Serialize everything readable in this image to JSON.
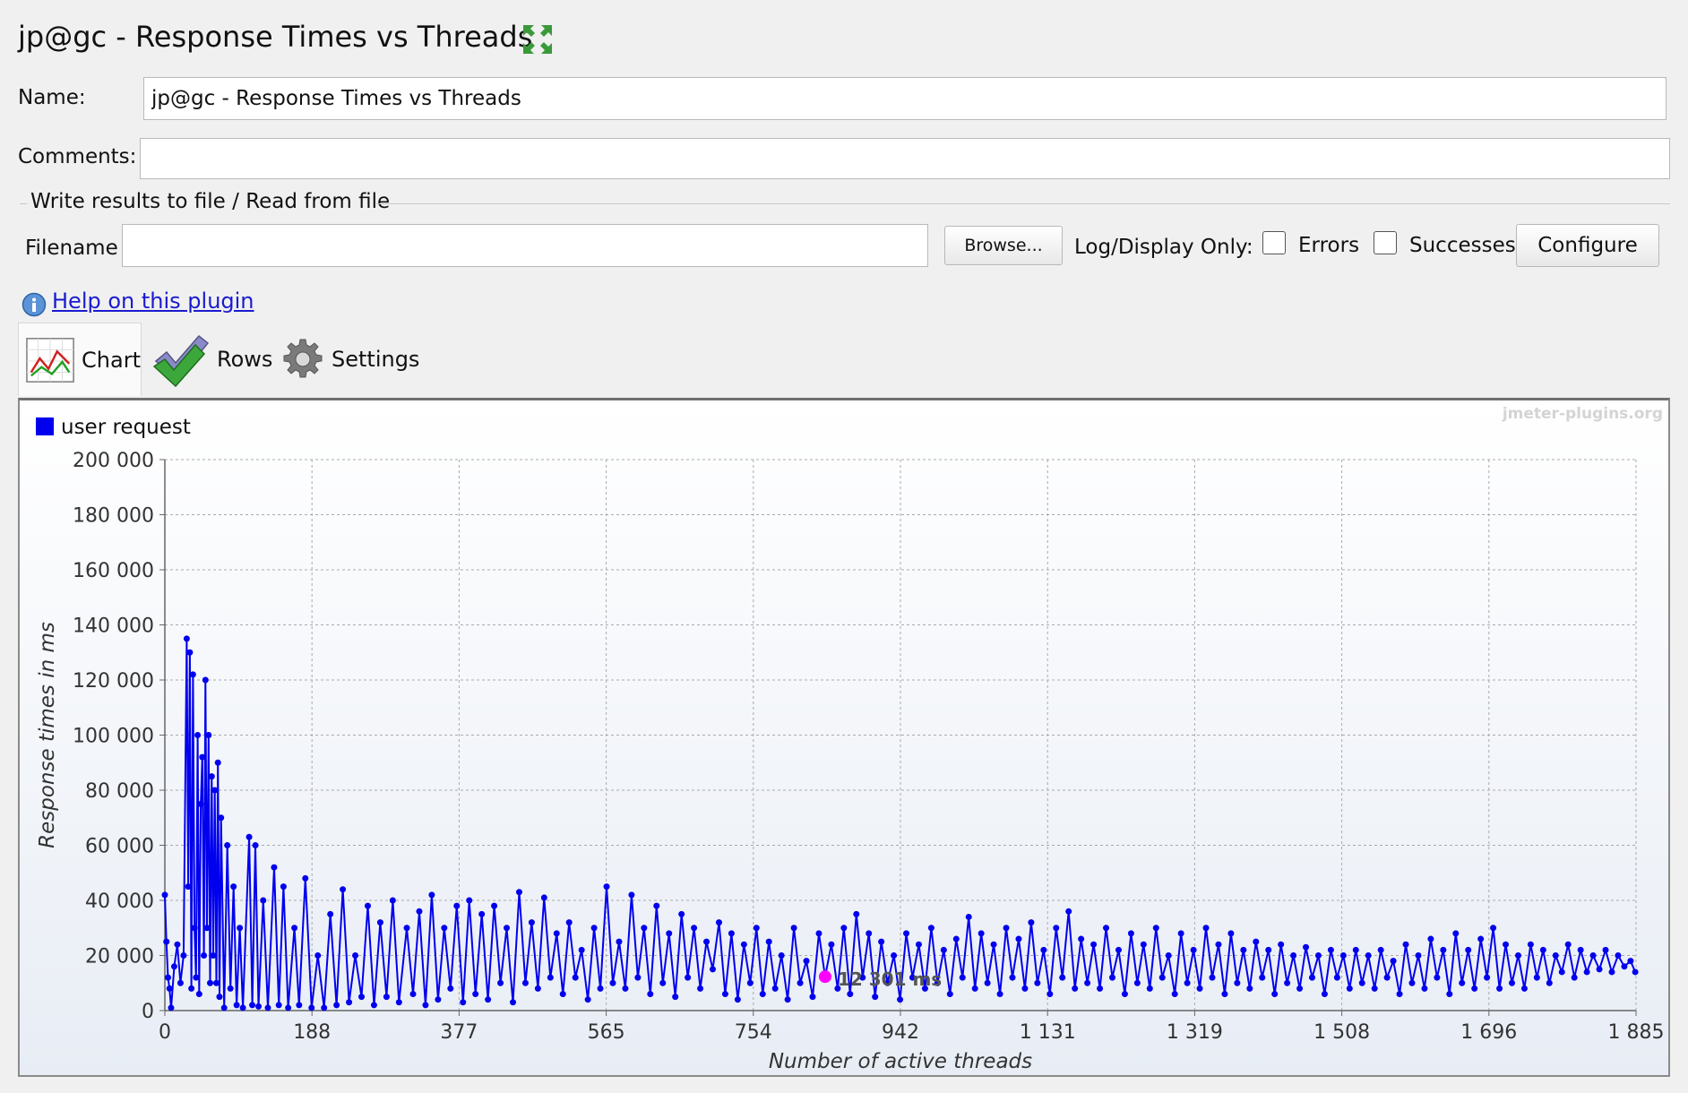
{
  "window": {
    "title": "jp@gc - Response Times vs Threads"
  },
  "form": {
    "name_label": "Name:",
    "name_value": "jp@gc - Response Times vs Threads",
    "comments_label": "Comments:",
    "comments_value": "",
    "file_group_label": "Write results to file / Read from file",
    "filename_label": "Filename",
    "filename_value": "",
    "browse_label": "Browse...",
    "log_display_label": "Log/Display Only:",
    "errors_label": "Errors",
    "errors_checked": false,
    "successes_label": "Successes",
    "successes_checked": false,
    "configure_label": "Configure"
  },
  "help": {
    "link_label": "Help on this plugin",
    "icon": "info-icon"
  },
  "tabs": [
    {
      "label": "Chart",
      "icon": "chart-icon",
      "selected": true
    },
    {
      "label": "Rows",
      "icon": "checkmark-icon",
      "selected": false
    },
    {
      "label": "Settings",
      "icon": "gear-icon",
      "selected": false
    }
  ],
  "chart_data": {
    "type": "line",
    "watermark": "jmeter-plugins.org",
    "xlabel": "Number of active threads",
    "ylabel": "Response times in ms",
    "xlim": [
      0,
      1885
    ],
    "ylim": [
      0,
      200000
    ],
    "x_ticks": [
      "0",
      "188",
      "377",
      "565",
      "754",
      "942",
      "1 131",
      "1 319",
      "1 508",
      "1 696",
      "1 885"
    ],
    "y_ticks": [
      "0",
      "20 000",
      "40 000",
      "60 000",
      "80 000",
      "100 000",
      "120 000",
      "140 000",
      "160 000",
      "180 000",
      "200 000"
    ],
    "grid": true,
    "legend_position": "top-left",
    "series": [
      {
        "name": "user request",
        "color": "#0000ee",
        "points": [
          [
            0,
            42000
          ],
          [
            2,
            25000
          ],
          [
            4,
            12000
          ],
          [
            6,
            8000
          ],
          [
            8,
            1000
          ],
          [
            12,
            16000
          ],
          [
            16,
            24000
          ],
          [
            20,
            10000
          ],
          [
            24,
            20000
          ],
          [
            28,
            135000
          ],
          [
            30,
            45000
          ],
          [
            32,
            130000
          ],
          [
            34,
            8000
          ],
          [
            36,
            122000
          ],
          [
            38,
            30000
          ],
          [
            40,
            12000
          ],
          [
            42,
            100000
          ],
          [
            44,
            6000
          ],
          [
            46,
            75000
          ],
          [
            48,
            92000
          ],
          [
            50,
            20000
          ],
          [
            52,
            120000
          ],
          [
            54,
            30000
          ],
          [
            56,
            100000
          ],
          [
            58,
            10000
          ],
          [
            60,
            85000
          ],
          [
            62,
            20000
          ],
          [
            64,
            80000
          ],
          [
            66,
            10000
          ],
          [
            68,
            90000
          ],
          [
            70,
            5000
          ],
          [
            72,
            70000
          ],
          [
            76,
            1000
          ],
          [
            80,
            60000
          ],
          [
            84,
            8000
          ],
          [
            88,
            45000
          ],
          [
            92,
            2000
          ],
          [
            96,
            30000
          ],
          [
            100,
            1000
          ],
          [
            108,
            63000
          ],
          [
            112,
            2000
          ],
          [
            116,
            60000
          ],
          [
            120,
            1500
          ],
          [
            126,
            40000
          ],
          [
            132,
            1000
          ],
          [
            140,
            52000
          ],
          [
            146,
            2000
          ],
          [
            152,
            45000
          ],
          [
            158,
            1000
          ],
          [
            166,
            30000
          ],
          [
            172,
            2000
          ],
          [
            180,
            48000
          ],
          [
            188,
            1000
          ],
          [
            196,
            20000
          ],
          [
            204,
            1000
          ],
          [
            212,
            35000
          ],
          [
            220,
            2000
          ],
          [
            228,
            44000
          ],
          [
            236,
            3000
          ],
          [
            244,
            20000
          ],
          [
            252,
            5000
          ],
          [
            260,
            38000
          ],
          [
            268,
            2000
          ],
          [
            276,
            32000
          ],
          [
            284,
            5000
          ],
          [
            292,
            40000
          ],
          [
            300,
            3000
          ],
          [
            310,
            30000
          ],
          [
            318,
            6000
          ],
          [
            326,
            36000
          ],
          [
            334,
            2000
          ],
          [
            342,
            42000
          ],
          [
            350,
            4000
          ],
          [
            358,
            30000
          ],
          [
            366,
            8000
          ],
          [
            374,
            38000
          ],
          [
            382,
            3000
          ],
          [
            390,
            40000
          ],
          [
            398,
            6000
          ],
          [
            406,
            35000
          ],
          [
            414,
            4000
          ],
          [
            422,
            38000
          ],
          [
            430,
            10000
          ],
          [
            438,
            30000
          ],
          [
            446,
            3000
          ],
          [
            454,
            43000
          ],
          [
            462,
            10000
          ],
          [
            470,
            32000
          ],
          [
            478,
            8000
          ],
          [
            486,
            41000
          ],
          [
            494,
            12000
          ],
          [
            502,
            28000
          ],
          [
            510,
            6000
          ],
          [
            518,
            32000
          ],
          [
            526,
            12000
          ],
          [
            534,
            22000
          ],
          [
            542,
            4000
          ],
          [
            550,
            30000
          ],
          [
            558,
            8000
          ],
          [
            566,
            45000
          ],
          [
            574,
            10000
          ],
          [
            582,
            25000
          ],
          [
            590,
            8000
          ],
          [
            598,
            42000
          ],
          [
            606,
            12000
          ],
          [
            614,
            30000
          ],
          [
            622,
            6000
          ],
          [
            630,
            38000
          ],
          [
            638,
            10000
          ],
          [
            646,
            28000
          ],
          [
            654,
            5000
          ],
          [
            662,
            35000
          ],
          [
            670,
            12000
          ],
          [
            678,
            30000
          ],
          [
            686,
            8000
          ],
          [
            694,
            25000
          ],
          [
            702,
            15000
          ],
          [
            710,
            32000
          ],
          [
            718,
            6000
          ],
          [
            726,
            28000
          ],
          [
            734,
            4000
          ],
          [
            742,
            24000
          ],
          [
            750,
            10000
          ],
          [
            758,
            30000
          ],
          [
            766,
            6000
          ],
          [
            774,
            25000
          ],
          [
            782,
            8000
          ],
          [
            790,
            20000
          ],
          [
            798,
            4000
          ],
          [
            806,
            30000
          ],
          [
            814,
            10000
          ],
          [
            822,
            18000
          ],
          [
            830,
            5000
          ],
          [
            838,
            28000
          ],
          [
            846,
            12300
          ],
          [
            854,
            24000
          ],
          [
            862,
            8000
          ],
          [
            870,
            30000
          ],
          [
            878,
            6000
          ],
          [
            886,
            35000
          ],
          [
            894,
            12000
          ],
          [
            902,
            28000
          ],
          [
            910,
            5000
          ],
          [
            918,
            25000
          ],
          [
            926,
            10000
          ],
          [
            934,
            20000
          ],
          [
            942,
            4000
          ],
          [
            950,
            28000
          ],
          [
            958,
            12000
          ],
          [
            966,
            24000
          ],
          [
            974,
            8000
          ],
          [
            982,
            30000
          ],
          [
            990,
            10000
          ],
          [
            998,
            22000
          ],
          [
            1006,
            6000
          ],
          [
            1014,
            26000
          ],
          [
            1022,
            12000
          ],
          [
            1030,
            34000
          ],
          [
            1038,
            8000
          ],
          [
            1046,
            28000
          ],
          [
            1054,
            10000
          ],
          [
            1062,
            24000
          ],
          [
            1070,
            6000
          ],
          [
            1078,
            30000
          ],
          [
            1086,
            12000
          ],
          [
            1094,
            26000
          ],
          [
            1102,
            8000
          ],
          [
            1110,
            32000
          ],
          [
            1118,
            10000
          ],
          [
            1126,
            22000
          ],
          [
            1134,
            6000
          ],
          [
            1142,
            30000
          ],
          [
            1150,
            12000
          ],
          [
            1158,
            36000
          ],
          [
            1166,
            8000
          ],
          [
            1174,
            26000
          ],
          [
            1182,
            10000
          ],
          [
            1190,
            24000
          ],
          [
            1198,
            8000
          ],
          [
            1206,
            30000
          ],
          [
            1214,
            12000
          ],
          [
            1222,
            22000
          ],
          [
            1230,
            6000
          ],
          [
            1238,
            28000
          ],
          [
            1246,
            10000
          ],
          [
            1254,
            24000
          ],
          [
            1262,
            8000
          ],
          [
            1270,
            30000
          ],
          [
            1278,
            12000
          ],
          [
            1286,
            20000
          ],
          [
            1294,
            6000
          ],
          [
            1302,
            28000
          ],
          [
            1310,
            10000
          ],
          [
            1318,
            22000
          ],
          [
            1326,
            8000
          ],
          [
            1334,
            30000
          ],
          [
            1342,
            12000
          ],
          [
            1350,
            24000
          ],
          [
            1358,
            6000
          ],
          [
            1366,
            28000
          ],
          [
            1374,
            10000
          ],
          [
            1382,
            22000
          ],
          [
            1390,
            8000
          ],
          [
            1398,
            25000
          ],
          [
            1406,
            12000
          ],
          [
            1414,
            22000
          ],
          [
            1422,
            6000
          ],
          [
            1430,
            24000
          ],
          [
            1438,
            10000
          ],
          [
            1446,
            20000
          ],
          [
            1454,
            8000
          ],
          [
            1462,
            23000
          ],
          [
            1470,
            12000
          ],
          [
            1478,
            20000
          ],
          [
            1486,
            6000
          ],
          [
            1494,
            22000
          ],
          [
            1502,
            12000
          ],
          [
            1510,
            20000
          ],
          [
            1518,
            8000
          ],
          [
            1526,
            22000
          ],
          [
            1534,
            10000
          ],
          [
            1542,
            20000
          ],
          [
            1550,
            8000
          ],
          [
            1558,
            22000
          ],
          [
            1566,
            12000
          ],
          [
            1574,
            18000
          ],
          [
            1582,
            6000
          ],
          [
            1590,
            24000
          ],
          [
            1598,
            10000
          ],
          [
            1606,
            20000
          ],
          [
            1614,
            8000
          ],
          [
            1622,
            26000
          ],
          [
            1630,
            12000
          ],
          [
            1638,
            22000
          ],
          [
            1646,
            6000
          ],
          [
            1654,
            28000
          ],
          [
            1662,
            10000
          ],
          [
            1670,
            22000
          ],
          [
            1678,
            8000
          ],
          [
            1686,
            26000
          ],
          [
            1694,
            12000
          ],
          [
            1702,
            30000
          ],
          [
            1710,
            8000
          ],
          [
            1718,
            24000
          ],
          [
            1726,
            10000
          ],
          [
            1734,
            20000
          ],
          [
            1742,
            8000
          ],
          [
            1750,
            24000
          ],
          [
            1758,
            12000
          ],
          [
            1766,
            22000
          ],
          [
            1774,
            10000
          ],
          [
            1782,
            20000
          ],
          [
            1790,
            14000
          ],
          [
            1798,
            24000
          ],
          [
            1806,
            12000
          ],
          [
            1814,
            22000
          ],
          [
            1822,
            14000
          ],
          [
            1830,
            20000
          ],
          [
            1838,
            15000
          ],
          [
            1846,
            22000
          ],
          [
            1854,
            14000
          ],
          [
            1862,
            20000
          ],
          [
            1870,
            16000
          ],
          [
            1878,
            18000
          ],
          [
            1884,
            14000
          ]
        ]
      }
    ],
    "annotations": [
      {
        "type": "highlight-point",
        "x": 846,
        "y": 12300,
        "color": "#ff00ff",
        "label": "12 301 ms"
      }
    ]
  }
}
